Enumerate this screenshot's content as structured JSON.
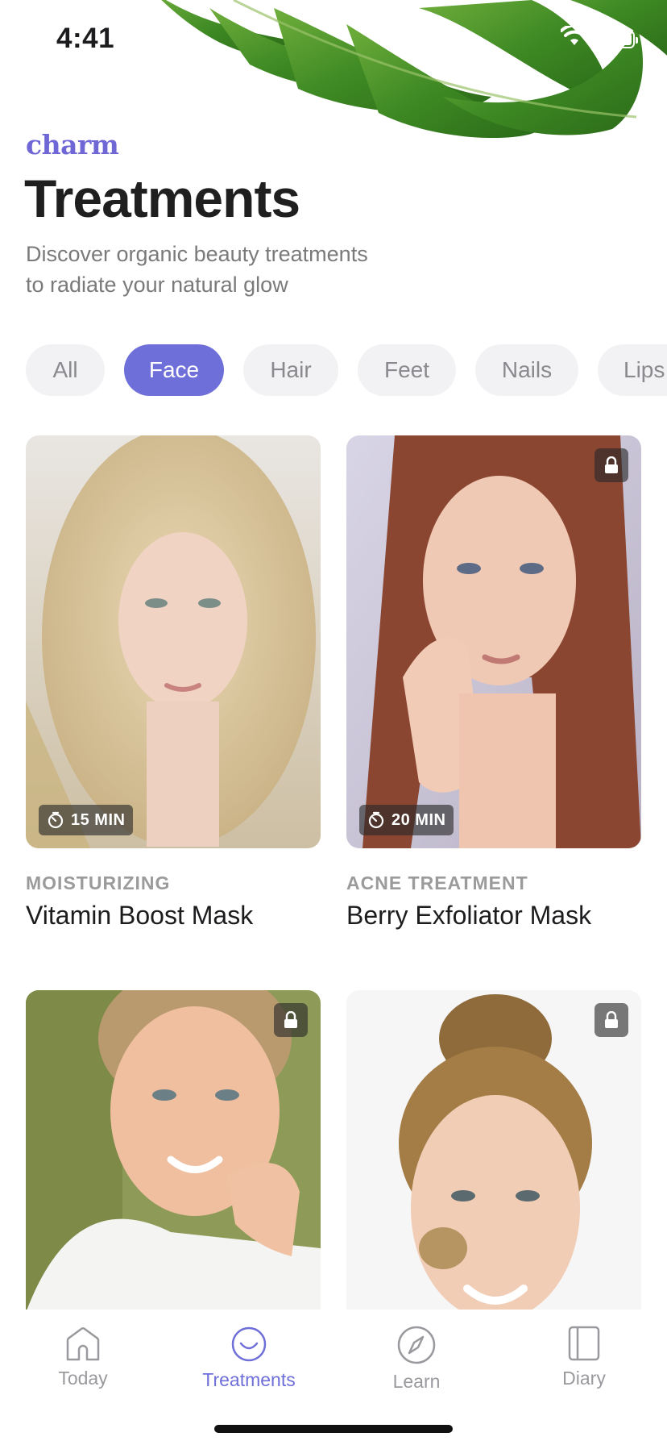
{
  "status_bar": {
    "time": "4:41"
  },
  "header": {
    "brand": "charm",
    "title": "Treatments",
    "subtitle_line1": "Discover organic beauty treatments",
    "subtitle_line2": "to radiate your natural glow"
  },
  "filters": {
    "selected": "Face",
    "items": [
      {
        "label": "All"
      },
      {
        "label": "Face"
      },
      {
        "label": "Hair"
      },
      {
        "label": "Feet"
      },
      {
        "label": "Nails"
      },
      {
        "label": "Lips"
      }
    ]
  },
  "cards": [
    {
      "category": "MOISTURIZING",
      "title": "Vitamin Boost Mask",
      "duration": "15 MIN",
      "locked": false
    },
    {
      "category": "ACNE TREATMENT",
      "title": "Berry Exfoliator Mask",
      "duration": "20 MIN",
      "locked": true
    },
    {
      "category": "",
      "title": "",
      "duration": "",
      "locked": true
    },
    {
      "category": "",
      "title": "",
      "duration": "",
      "locked": true
    }
  ],
  "tabbar": {
    "selected": "Treatments",
    "items": [
      {
        "label": "Today",
        "icon": "home-icon"
      },
      {
        "label": "Treatments",
        "icon": "smile-icon"
      },
      {
        "label": "Learn",
        "icon": "compass-icon"
      },
      {
        "label": "Diary",
        "icon": "book-icon"
      }
    ]
  },
  "colors": {
    "accent": "#6f6fd9",
    "brand": "#6f67d6",
    "chip_bg": "#f2f2f4",
    "muted_text": "#9b9b9b"
  }
}
